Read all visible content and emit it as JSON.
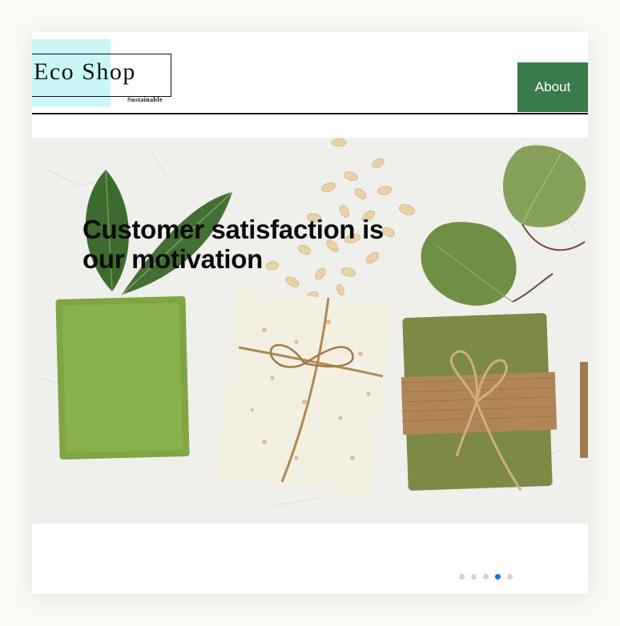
{
  "header": {
    "logo_text": "Eco Shop",
    "logo_subtitle": "Sustainable",
    "nav": {
      "about_label": "About"
    }
  },
  "hero": {
    "title": "Customer satisfaction is our motivation"
  },
  "carousel": {
    "slide_count": 5,
    "active_index": 3
  },
  "colors": {
    "accent_green": "#3a7a4b",
    "logo_highlight": "#c9f7f5",
    "active_dot": "#1b74d8",
    "inactive_dot": "#d3d3d3"
  }
}
